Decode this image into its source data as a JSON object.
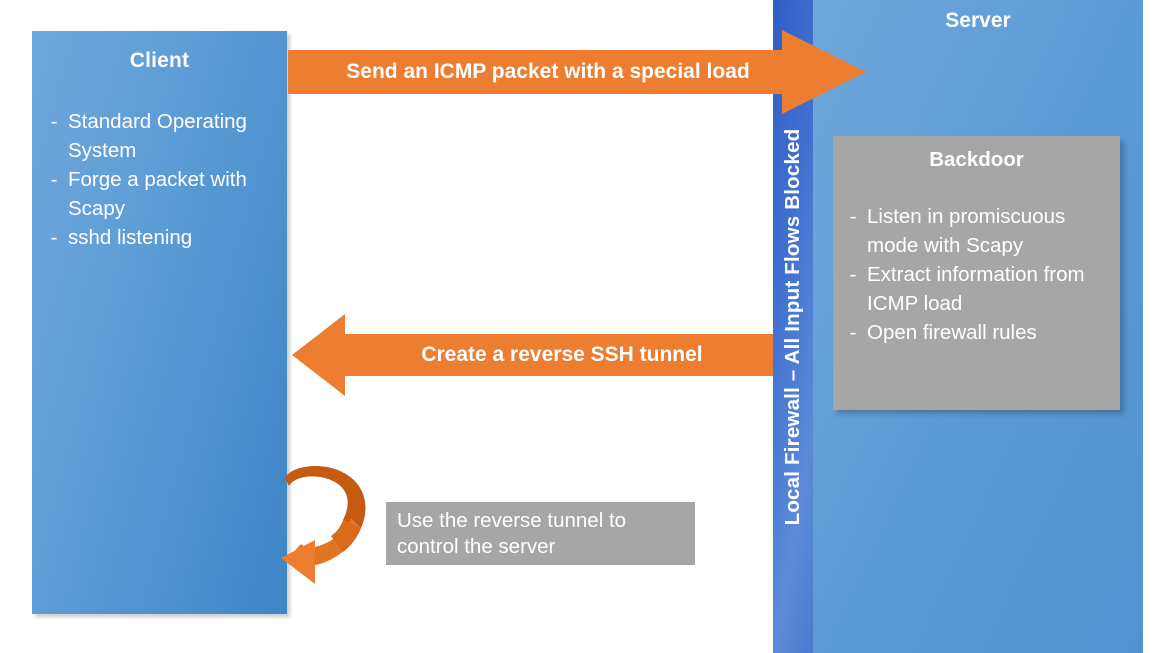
{
  "diagram": {
    "title": "ICMP backdoor reverse SSH tunnel diagram",
    "colors": {
      "client_blue": "#5b9bd5",
      "server_blue": "#5b9bd5",
      "firewall_blue": "#3f6fcf",
      "arrow_orange": "#ED7D31",
      "arrow_orange_dark": "#C55A11",
      "box_gray": "#A6A6A6",
      "text_white": "#FFFFFF",
      "background": "#FFFFFF"
    }
  },
  "client": {
    "title": "Client",
    "bullet_marker": "-",
    "items": [
      "Standard Operating System",
      "Forge a packet with Scapy",
      "sshd listening"
    ]
  },
  "firewall": {
    "label": "Local Firewall – All Input Flows Blocked"
  },
  "server": {
    "title": "Server",
    "backdoor": {
      "title": "Backdoor",
      "bullet_marker": "-",
      "items": [
        "Listen in promiscuous mode with Scapy",
        "Extract information from ICMP load",
        "Open firewall rules"
      ]
    }
  },
  "arrows": {
    "to_server": {
      "label": "Send an ICMP packet with a special load",
      "direction": "right"
    },
    "to_client": {
      "label": "Create a reverse SSH tunnel",
      "direction": "left"
    },
    "loop": {
      "direction": "circular",
      "icon": "circular-loop-arrow-icon"
    }
  },
  "callout": {
    "text": "Use the reverse tunnel to control the server"
  }
}
